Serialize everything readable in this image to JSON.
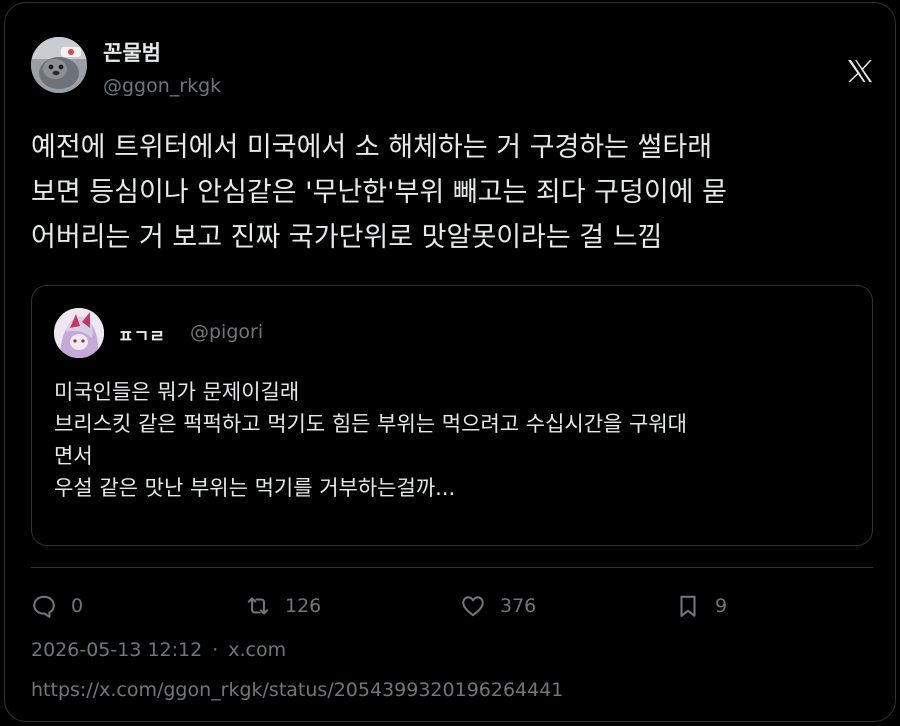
{
  "author": {
    "display_name": "꼰물범",
    "handle": "@ggon_rkgk"
  },
  "brand_icon": "x-logo-icon",
  "tweet": {
    "lines": [
      "예전에 트위터에서 미국에서 소 해체하는 거 구경하는 썰타래",
      "보면 등심이나 안심같은 '무난한'부위 빼고는 죄다 구덩이에 묻",
      "어버리는 거 보고 진짜 국가단위로 맛알못이라는 걸 느낌"
    ]
  },
  "quoted": {
    "display_name": "ㅍㄱㄹ",
    "handle": "@pigori",
    "lines": [
      "미국인들은 뭐가 문제이길래",
      "브리스킷 같은 퍽퍽하고 먹기도 힘든 부위는 먹으려고 수십시간을 구워대",
      "면서",
      "우설 같은 맛난 부위는 먹기를 거부하는걸까..."
    ]
  },
  "actions": {
    "reply": {
      "icon": "reply-icon",
      "count": "0"
    },
    "retweet": {
      "icon": "retweet-icon",
      "count": "126"
    },
    "like": {
      "icon": "heart-icon",
      "count": "376"
    },
    "bookmark": {
      "icon": "bookmark-icon",
      "count": "9"
    }
  },
  "meta": {
    "timestamp": "2026-05-13 12:12",
    "separator": "·",
    "source": "x.com"
  },
  "url": "https://x.com/ggon_rkgk/status/2054399320196264441",
  "colors": {
    "background": "#000000",
    "text": "#e7e9ea",
    "muted": "#71767b",
    "border": "#2f3336"
  }
}
